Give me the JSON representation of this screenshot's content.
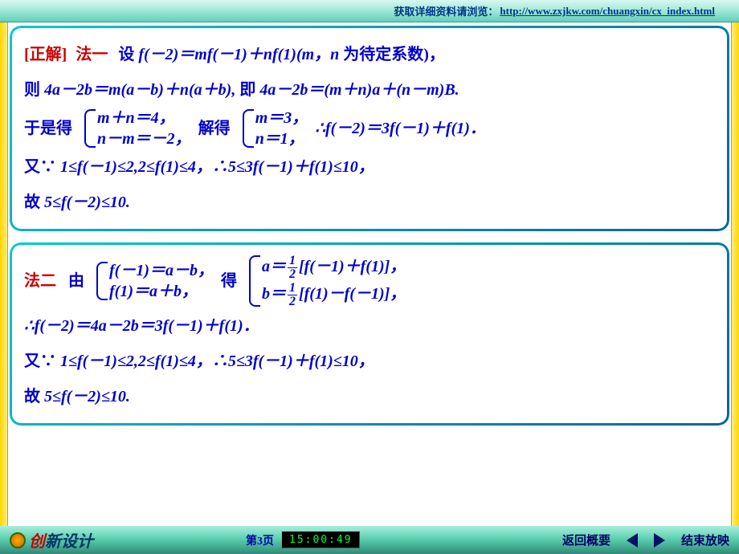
{
  "header": {
    "prefix": "获取详细资料请浏览：",
    "url": "http://www.zxjkw.com/chuangxin/cx_index.html"
  },
  "panel1": {
    "tag": "[正解]",
    "method_label": "法一",
    "line1_a": "设",
    "line1_b": "f(－2)＝mf(－1)＋nf(1)(m，n",
    "line1_c": "为待定系数)，",
    "line2_a": "则",
    "line2_b": "4a－2b＝m(a－b)＋n(a＋b),",
    "line2_c": "即",
    "line2_d": "4a－2b＝(m＋n)a＋(n－m)B.",
    "line3_a": "于是得",
    "brace1_r1": "m＋n＝4，",
    "brace1_r2": "n－m＝－2，",
    "line3_b": "解得",
    "brace2_r1": "m＝3，",
    "brace2_r2": "n＝1，",
    "line3_c": "∴f(－2)＝3f(－1)＋f(1)．",
    "line4_a": "又∵",
    "line4_b": "1≤f(－1)≤2,2≤f(1)≤4，∴5≤3f(－1)＋f(1)≤10，",
    "line5_a": "故",
    "line5_b": "5≤f(－2)≤10."
  },
  "panel2": {
    "method_label": "法二",
    "pre1": "由",
    "braceA_r1": "f(－1)＝a－b，",
    "braceA_r2": "f(1)＝a＋b，",
    "mid1": "得",
    "braceB_r1_pre": "a＝",
    "braceB_r1_post": "[f(－1)＋f(1)]，",
    "braceB_r2_pre": "b＝",
    "braceB_r2_post": "[f(1)－f(－1)]，",
    "frac_num": "1",
    "frac_den": "2",
    "line2": "∴f(－2)＝4a－2b＝3f(－1)＋f(1)．",
    "line3_a": "又∵",
    "line3_b": "1≤f(－1)≤2,2≤f(1)≤4，∴5≤3f(－1)＋f(1)≤10，",
    "line4_a": "故",
    "line4_b": "5≤f(－2)≤10."
  },
  "footer": {
    "logo_a": "创",
    "logo_b": "新设计",
    "page": "第3页",
    "clock": "15:00:49",
    "back": "返回概要",
    "end": "结束放映"
  }
}
